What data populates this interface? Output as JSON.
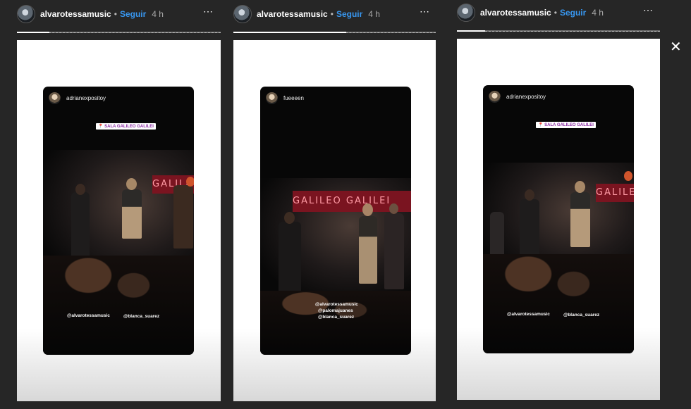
{
  "stories": [
    {
      "username": "alvarotessamusic",
      "follow_label": "Seguir",
      "time_ago": "4 h",
      "more_icon": "⋯",
      "inner": {
        "username": "adrianexpositoy",
        "location": "📍 SALA GALILEO GALILEI",
        "mentions": [
          "@alvarotessamusic",
          "@blanca_suarez"
        ]
      }
    },
    {
      "username": "alvarotessamusic",
      "follow_label": "Seguir",
      "time_ago": "4 h",
      "more_icon": "⋯",
      "inner": {
        "username": "fueeeen",
        "banner": "GALILEO  GALILEI",
        "mentions": [
          "@alvarotessamusic",
          "@palomajuanes",
          "@blanca_suarez"
        ]
      }
    },
    {
      "username": "alvarotessamusic",
      "follow_label": "Seguir",
      "time_ago": "4 h",
      "more_icon": "⋯",
      "inner": {
        "username": "adrianexpositoy",
        "location": "📍 SALA GALILEO GALILEI",
        "mentions": [
          "@alvarotessamusic",
          "@blanca_suarez"
        ]
      }
    }
  ],
  "close_icon": "✕",
  "colors": {
    "background": "#262626",
    "follow": "#3897f0",
    "banner": "#7a1420"
  }
}
